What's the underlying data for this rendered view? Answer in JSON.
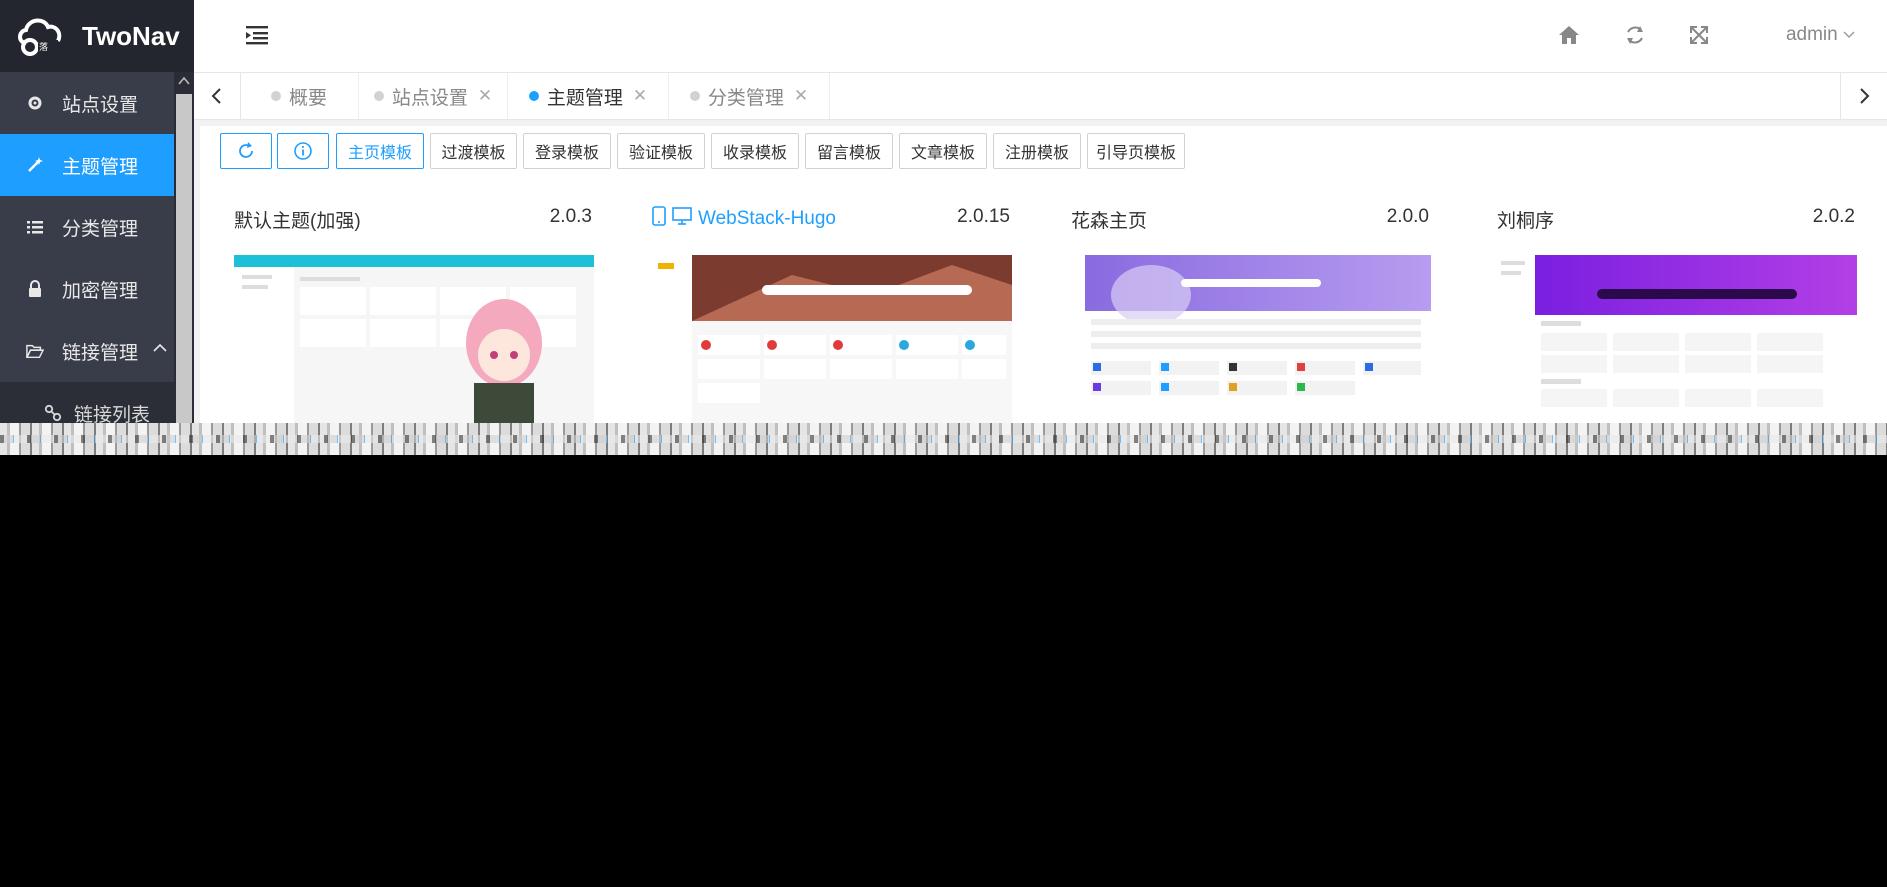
{
  "app": {
    "name": "TwoNav"
  },
  "header": {
    "user": "admin"
  },
  "sidebar": {
    "items": [
      {
        "label": "站点设置",
        "icon": "gear-icon"
      },
      {
        "label": "主题管理",
        "icon": "magic-wand-icon",
        "active": true
      },
      {
        "label": "分类管理",
        "icon": "list-icon"
      },
      {
        "label": "加密管理",
        "icon": "lock-icon"
      },
      {
        "label": "链接管理",
        "icon": "folder-open-icon",
        "expanded": true
      }
    ],
    "sub_items": [
      {
        "label": "链接列表",
        "icon": "link-icon"
      }
    ]
  },
  "tabs": [
    {
      "label": "概要",
      "closable": false
    },
    {
      "label": "站点设置",
      "closable": true
    },
    {
      "label": "主题管理",
      "closable": true,
      "active": true
    },
    {
      "label": "分类管理",
      "closable": true
    }
  ],
  "toolbar": {
    "buttons": [
      "主页模板",
      "过渡模板",
      "登录模板",
      "验证模板",
      "收录模板",
      "留言模板",
      "文章模板",
      "注册模板",
      "引导页模板"
    ]
  },
  "themes": [
    {
      "name": "默认主题(加强)",
      "version": "2.0.3"
    },
    {
      "name": "WebStack-Hugo",
      "version": "2.0.15",
      "highlight": true
    },
    {
      "name": "花森主页",
      "version": "2.0.0"
    },
    {
      "name": "刘桐序",
      "version": "2.0.2"
    }
  ],
  "colors": {
    "accent": "#1e9fff",
    "sidebar": "#393d49",
    "logo_bg": "#23262e"
  }
}
